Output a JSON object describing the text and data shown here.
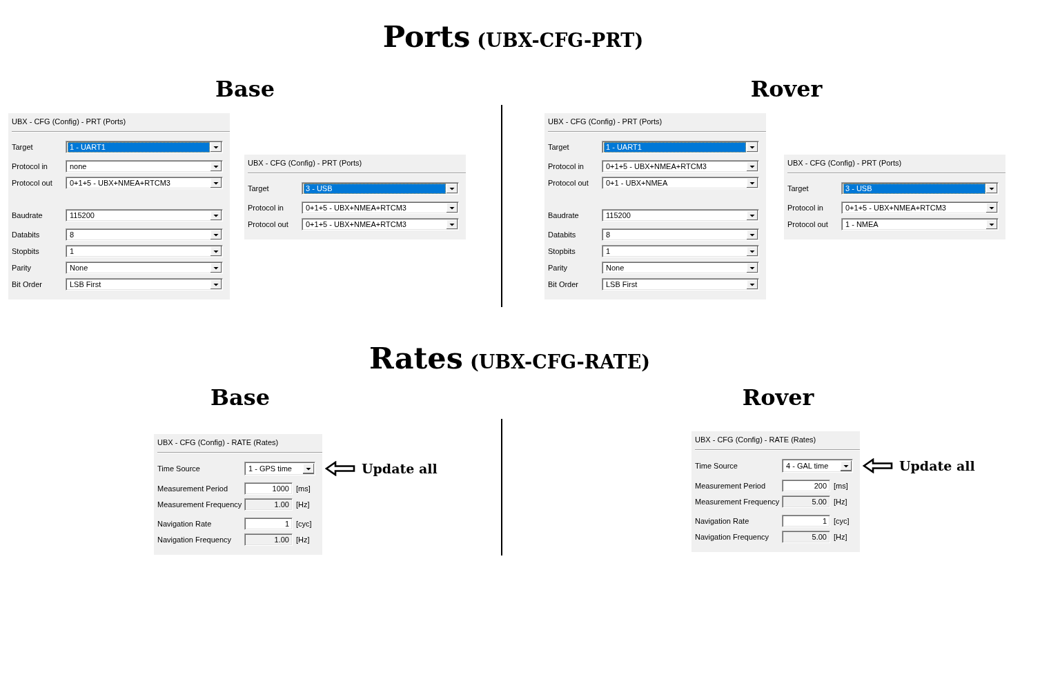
{
  "sections": [
    {
      "title": "Ports",
      "subtitle": "(UBX-CFG-PRT)",
      "columns": [
        {
          "heading": "Base",
          "panels": [
            {
              "title": "UBX - CFG (Config) - PRT (Ports)",
              "groups": [
                [
                  {
                    "kind": "select",
                    "label": "Target",
                    "value": "1 - UART1",
                    "focused": true
                  }
                ],
                [
                  {
                    "kind": "select",
                    "label": "Protocol in",
                    "value": "none",
                    "focused": false
                  },
                  {
                    "kind": "select",
                    "label": "Protocol out",
                    "value": "0+1+5 - UBX+NMEA+RTCM3",
                    "focused": false
                  }
                ],
                [
                  {
                    "kind": "select",
                    "label": "Baudrate",
                    "value": "115200",
                    "focused": false
                  }
                ],
                [
                  {
                    "kind": "select",
                    "label": "Databits",
                    "value": "8",
                    "focused": false
                  },
                  {
                    "kind": "select",
                    "label": "Stopbits",
                    "value": "1",
                    "focused": false
                  },
                  {
                    "kind": "select",
                    "label": "Parity",
                    "value": "None",
                    "focused": false
                  },
                  {
                    "kind": "select",
                    "label": "Bit Order",
                    "value": "LSB First",
                    "focused": false
                  }
                ]
              ]
            },
            {
              "title": "UBX - CFG (Config) - PRT (Ports)",
              "groups": [
                [
                  {
                    "kind": "select",
                    "label": "Target",
                    "value": "3 - USB",
                    "focused": true
                  }
                ],
                [
                  {
                    "kind": "select",
                    "label": "Protocol in",
                    "value": "0+1+5 - UBX+NMEA+RTCM3",
                    "focused": false
                  },
                  {
                    "kind": "select",
                    "label": "Protocol out",
                    "value": "0+1+5 - UBX+NMEA+RTCM3",
                    "focused": false
                  }
                ]
              ]
            }
          ]
        },
        {
          "heading": "Rover",
          "panels": [
            {
              "title": "UBX - CFG (Config) - PRT (Ports)",
              "groups": [
                [
                  {
                    "kind": "select",
                    "label": "Target",
                    "value": "1 - UART1",
                    "focused": true
                  }
                ],
                [
                  {
                    "kind": "select",
                    "label": "Protocol in",
                    "value": "0+1+5 - UBX+NMEA+RTCM3",
                    "focused": false
                  },
                  {
                    "kind": "select",
                    "label": "Protocol out",
                    "value": "0+1 - UBX+NMEA",
                    "focused": false
                  }
                ],
                [
                  {
                    "kind": "select",
                    "label": "Baudrate",
                    "value": "115200",
                    "focused": false
                  }
                ],
                [
                  {
                    "kind": "select",
                    "label": "Databits",
                    "value": "8",
                    "focused": false
                  },
                  {
                    "kind": "select",
                    "label": "Stopbits",
                    "value": "1",
                    "focused": false
                  },
                  {
                    "kind": "select",
                    "label": "Parity",
                    "value": "None",
                    "focused": false
                  },
                  {
                    "kind": "select",
                    "label": "Bit Order",
                    "value": "LSB First",
                    "focused": false
                  }
                ]
              ]
            },
            {
              "title": "UBX - CFG (Config) - PRT (Ports)",
              "groups": [
                [
                  {
                    "kind": "select",
                    "label": "Target",
                    "value": "3 - USB",
                    "focused": true
                  }
                ],
                [
                  {
                    "kind": "select",
                    "label": "Protocol in",
                    "value": "0+1+5 - UBX+NMEA+RTCM3",
                    "focused": false
                  },
                  {
                    "kind": "select",
                    "label": "Protocol out",
                    "value": "1 - NMEA",
                    "focused": false
                  }
                ]
              ]
            }
          ]
        }
      ]
    },
    {
      "title": "Rates",
      "subtitle": "(UBX-CFG-RATE)",
      "columns": [
        {
          "heading": "Base",
          "panels": [
            {
              "title": "UBX - CFG (Config) - RATE (Rates)",
              "groups": [
                [
                  {
                    "kind": "select",
                    "label": "Time Source",
                    "value": "1 - GPS time",
                    "focused": false
                  }
                ],
                [
                  {
                    "kind": "number",
                    "label": "Measurement Period",
                    "value": "1000",
                    "unit": "[ms]",
                    "readonly": false
                  },
                  {
                    "kind": "number",
                    "label": "Measurement Frequency",
                    "value": "1.00",
                    "unit": "[Hz]",
                    "readonly": true
                  }
                ],
                [
                  {
                    "kind": "number",
                    "label": "Navigation Rate",
                    "value": "1",
                    "unit": "[cyc]",
                    "readonly": false
                  },
                  {
                    "kind": "number",
                    "label": "Navigation Frequency",
                    "value": "1.00",
                    "unit": "[Hz]",
                    "readonly": true
                  }
                ]
              ]
            }
          ],
          "annotation": "Update all"
        },
        {
          "heading": "Rover",
          "panels": [
            {
              "title": "UBX - CFG (Config) - RATE (Rates)",
              "groups": [
                [
                  {
                    "kind": "select",
                    "label": "Time Source",
                    "value": "4 - GAL time",
                    "focused": false
                  }
                ],
                [
                  {
                    "kind": "number",
                    "label": "Measurement Period",
                    "value": "200",
                    "unit": "[ms]",
                    "readonly": false
                  },
                  {
                    "kind": "number",
                    "label": "Measurement Frequency",
                    "value": "5.00",
                    "unit": "[Hz]",
                    "readonly": true
                  }
                ],
                [
                  {
                    "kind": "number",
                    "label": "Navigation Rate",
                    "value": "1",
                    "unit": "[cyc]",
                    "readonly": false
                  },
                  {
                    "kind": "number",
                    "label": "Navigation Frequency",
                    "value": "5.00",
                    "unit": "[Hz]",
                    "readonly": true
                  }
                ]
              ]
            }
          ],
          "annotation": "Update all"
        }
      ]
    }
  ]
}
